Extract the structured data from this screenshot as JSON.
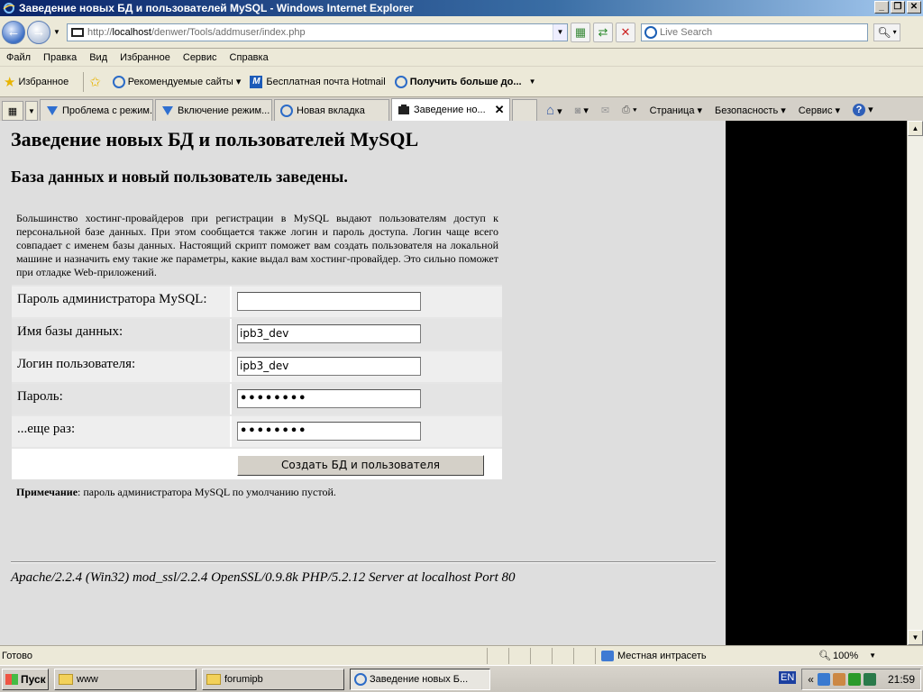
{
  "window": {
    "title": "Заведение новых БД и пользователей MySQL - Windows Internet Explorer"
  },
  "address_bar": {
    "url_prefix": "http://",
    "url_host": "localhost",
    "url_path": "/denwer/Tools/addmuser/index.php",
    "search_placeholder": "Live Search"
  },
  "menu": [
    "Файл",
    "Правка",
    "Вид",
    "Избранное",
    "Сервис",
    "Справка"
  ],
  "favorites_bar": {
    "favorites_label": "Избранное",
    "items": [
      "Рекомендуемые сайты ▾",
      "Бесплатная почта Hotmail",
      "Получить больше до..."
    ]
  },
  "tabs": [
    {
      "label": "Проблема с режим...",
      "active": false
    },
    {
      "label": "Включение режим...",
      "active": false
    },
    {
      "label": "Новая вкладка",
      "active": false
    },
    {
      "label": "Заведение но...",
      "active": true
    }
  ],
  "command_bar": {
    "page": "Страница ▾",
    "safety": "Безопасность ▾",
    "tools": "Сервис ▾"
  },
  "page": {
    "title": "Заведение новых БД и пользователей MySQL",
    "subtitle": "База данных и новый пользователь заведены.",
    "description": "Большинство хостинг-провайдеров при регистрации в MySQL выдают пользователям доступ к персональной базе данных. При этом сообщается также логин и пароль доступа. Логин чаще всего совпадает с именем базы данных. Настоящий скрипт поможет вам создать пользователя на локальной машине и назначить ему такие же параметры, какие выдал вам хостинг-провайдер. Это сильно поможет при отладке Web-приложений.",
    "form": {
      "admin_password_label": "Пароль администратора MySQL:",
      "admin_password_value": "",
      "db_name_label": "Имя базы данных:",
      "db_name_value": "ipb3_dev",
      "user_login_label": "Логин пользователя:",
      "user_login_value": "ipb3_dev",
      "password_label": "Пароль:",
      "password_value": "••••••••",
      "password_repeat_label": "...еще раз:",
      "password_repeat_value": "••••••••",
      "submit_label": "Создать БД и пользователя"
    },
    "note_bold": "Примечание",
    "note_text": ": пароль администратора MySQL по умолчанию пустой.",
    "server_signature": "Apache/2.2.4 (Win32) mod_ssl/2.2.4 OpenSSL/0.9.8k PHP/5.2.12 Server at localhost Port 80"
  },
  "status_bar": {
    "status": "Готово",
    "zone": "Местная интрасеть",
    "zoom": "100%"
  },
  "taskbar": {
    "start": "Пуск",
    "tasks": [
      {
        "label": "www",
        "active": false
      },
      {
        "label": "forumipb",
        "active": false
      },
      {
        "label": "Заведение новых Б...",
        "active": true
      }
    ],
    "lang": "EN",
    "clock": "21:59"
  }
}
